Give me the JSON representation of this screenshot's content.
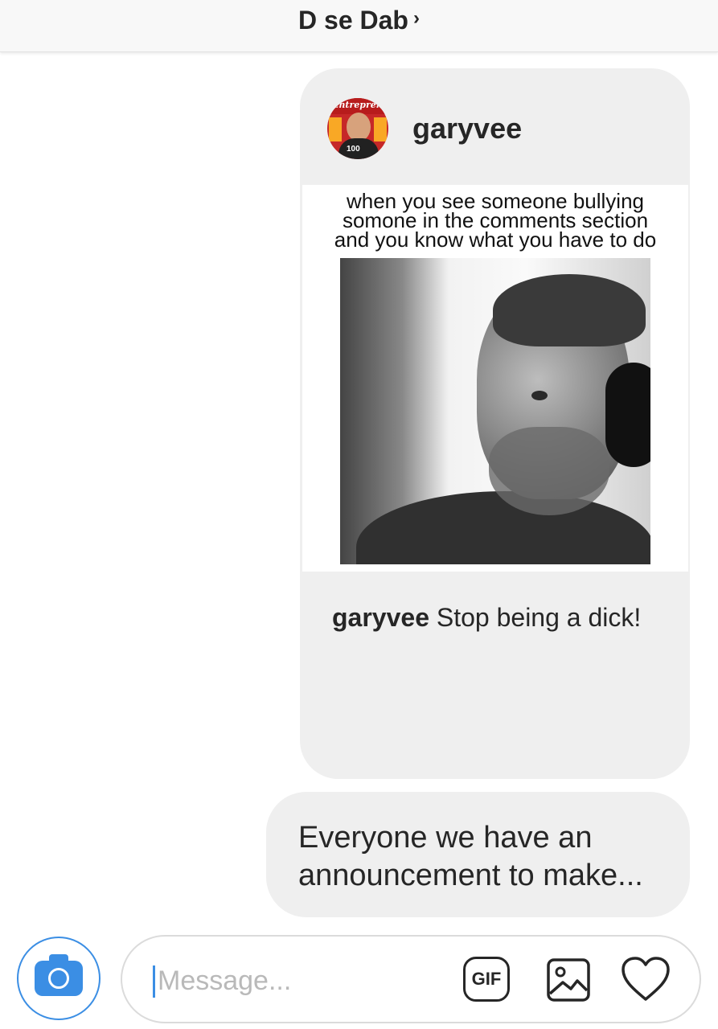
{
  "header": {
    "title": "D se Dab",
    "chevron": "›"
  },
  "shared_post": {
    "username": "garyvee",
    "meme_caption_lines": [
      "when you see someone bullying",
      "somone in the comments section",
      "and you know what you have to do"
    ],
    "comment_user": "garyvee",
    "comment_text": " Stop being a dick!",
    "avatar_magazine": "Entrepreneur",
    "avatar_number": "100"
  },
  "message": {
    "text": "Everyone we have an announcement to make..."
  },
  "composer": {
    "placeholder": "Message...",
    "value": "",
    "gif_label": "GIF",
    "icons": [
      "camera-icon",
      "gif-icon",
      "image-icon",
      "heart-icon"
    ],
    "accent_color": "#3b8ee4"
  }
}
